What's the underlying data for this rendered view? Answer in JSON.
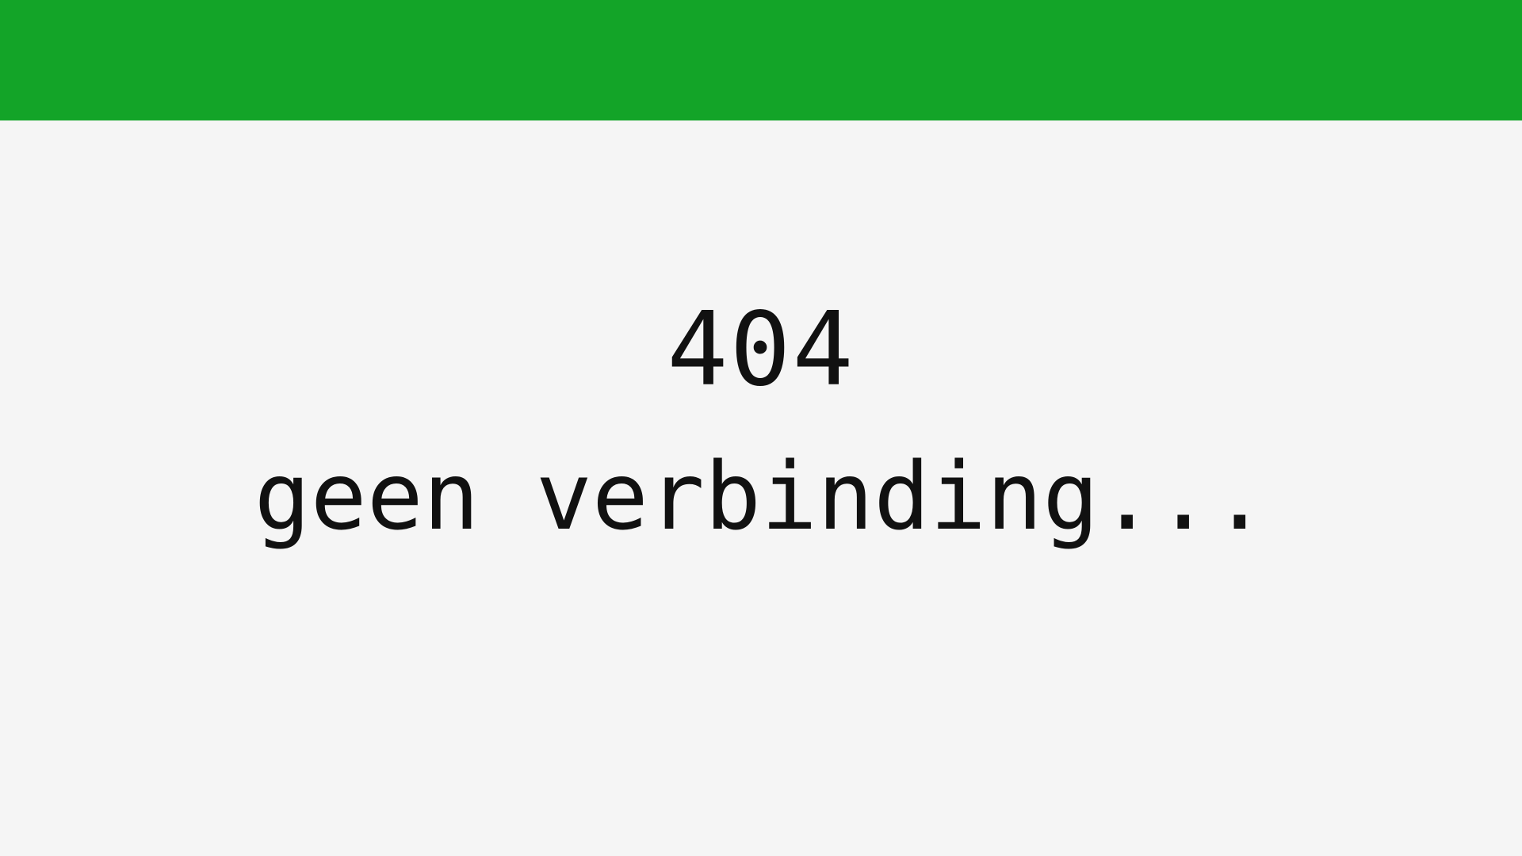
{
  "header": {
    "color": "#13a428"
  },
  "error": {
    "code": "404",
    "message": "geen verbinding..."
  },
  "colors": {
    "background": "#f5f5f5",
    "text": "#111111"
  }
}
